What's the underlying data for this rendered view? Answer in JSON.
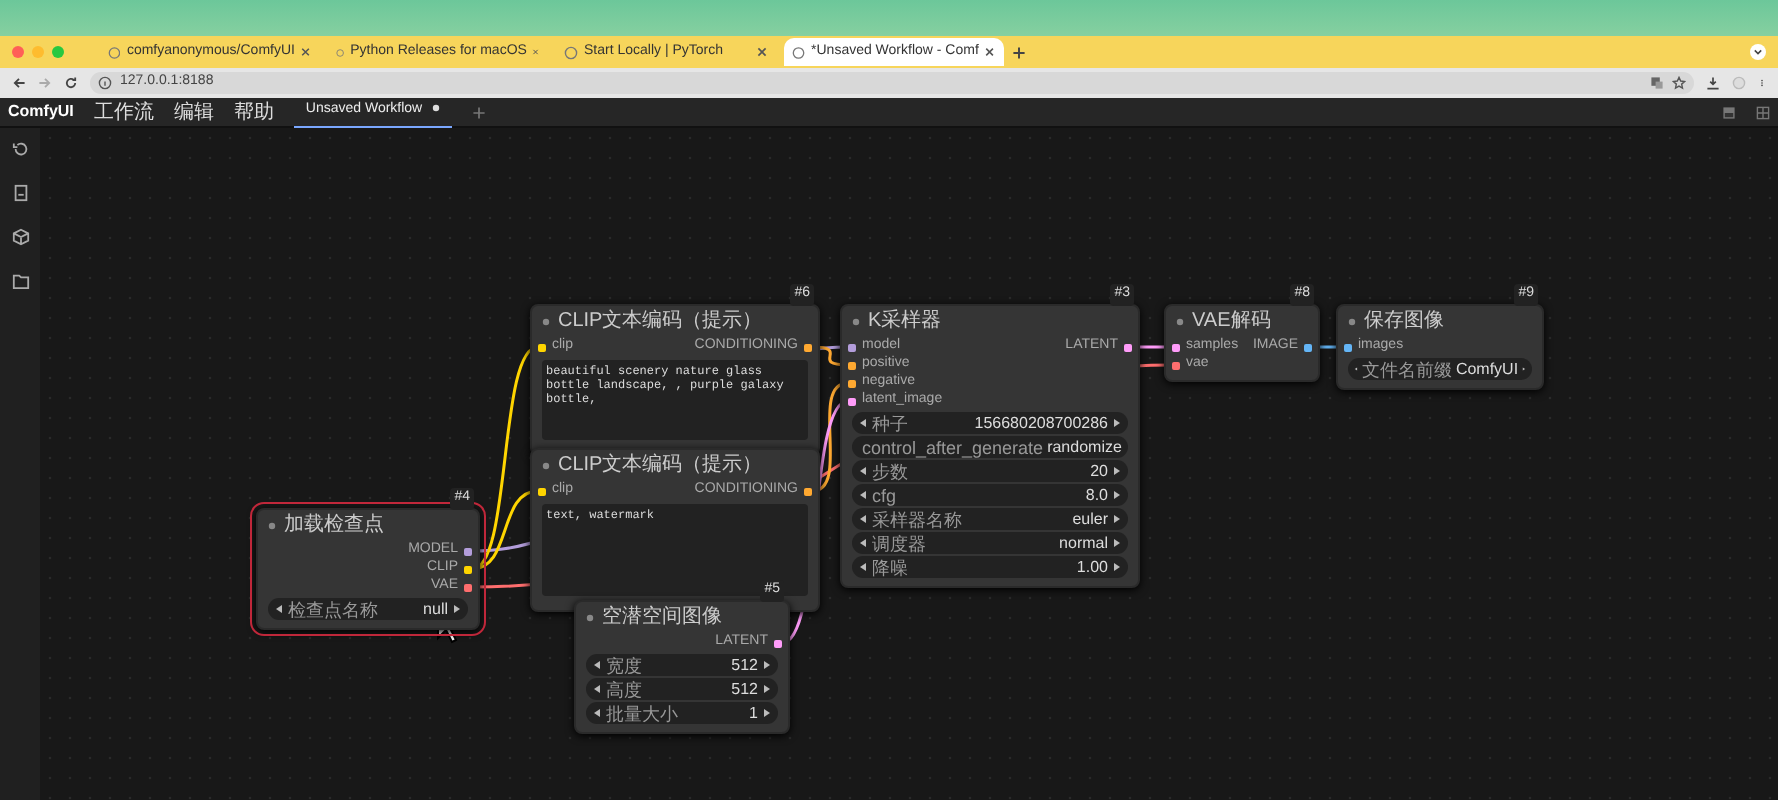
{
  "browser": {
    "tabs": [
      {
        "label": "comfyanonymous/ComfyUI",
        "selected": false
      },
      {
        "label": "Python Releases for macOS",
        "selected": false
      },
      {
        "label": "Start Locally | PyTorch",
        "selected": false
      },
      {
        "label": "*Unsaved Workflow - Comf",
        "selected": true
      }
    ],
    "url": "127.0.0.1:8188"
  },
  "app": {
    "logo": "ComfyUI",
    "menu": [
      "工作流",
      "编辑",
      "帮助"
    ],
    "workflow_tab": {
      "label": "Unsaved Workflow",
      "selected": true
    }
  },
  "nodes": [
    {
      "id": "#4",
      "title": "加载检查点",
      "selected": true,
      "outputs": [
        {
          "label": "MODEL",
          "color": "#b39ddb"
        },
        {
          "label": "CLIP",
          "color": "#ffd500"
        },
        {
          "label": "VAE",
          "color": "#ff6e6e"
        }
      ],
      "widgets": [
        {
          "label": "检查点名称",
          "value": "null"
        }
      ]
    },
    {
      "id": "#6",
      "title": "CLIP文本编码（提示）",
      "selected": false,
      "inputs": [
        {
          "label": "clip",
          "color": "#ffd500"
        }
      ],
      "outputs": [
        {
          "label": "CONDITIONING",
          "color": "#ffa931"
        }
      ],
      "text": "beautiful scenery nature glass bottle landscape, , purple galaxy bottle,"
    },
    {
      "title": "CLIP文本编码（提示）",
      "selected": false,
      "inputs": [
        {
          "label": "clip",
          "color": "#ffd500"
        }
      ],
      "outputs": [
        {
          "label": "CONDITIONING",
          "color": "#ffa931"
        }
      ],
      "text": "text, watermark"
    },
    {
      "id": "#5",
      "title": "空潜空间图像",
      "selected": false,
      "outputs": [
        {
          "label": "LATENT",
          "color": "#ff9cf9"
        }
      ],
      "widgets": [
        {
          "label": "宽度",
          "value": "512"
        },
        {
          "label": "高度",
          "value": "512"
        },
        {
          "label": "批量大小",
          "value": "1"
        }
      ]
    },
    {
      "id": "#3",
      "title": "K采样器",
      "selected": false,
      "inputs": [
        {
          "label": "model",
          "color": "#b39ddb"
        },
        {
          "label": "positive",
          "color": "#ffa931"
        },
        {
          "label": "negative",
          "color": "#ffa931"
        },
        {
          "label": "latent_image",
          "color": "#ff9cf9"
        }
      ],
      "outputs": [
        {
          "label": "LATENT",
          "color": "#ff9cf9"
        }
      ],
      "widgets": [
        {
          "label": "种子",
          "value": "156680208700286"
        },
        {
          "label": "control_after_generate",
          "value": "randomize"
        },
        {
          "label": "步数",
          "value": "20"
        },
        {
          "label": "cfg",
          "value": "8.0"
        },
        {
          "label": "采样器名称",
          "value": "euler"
        },
        {
          "label": "调度器",
          "value": "normal"
        },
        {
          "label": "降噪",
          "value": "1.00"
        }
      ]
    },
    {
      "id": "#8",
      "title": "VAE解码",
      "selected": false,
      "inputs": [
        {
          "label": "samples",
          "color": "#ff9cf9"
        },
        {
          "label": "vae",
          "color": "#ff6e6e"
        }
      ],
      "outputs": [
        {
          "label": "IMAGE",
          "color": "#64b5f6"
        }
      ]
    },
    {
      "id": "#9",
      "title": "保存图像",
      "selected": false,
      "inputs": [
        {
          "label": "images",
          "color": "#64b5f6"
        }
      ],
      "widgets": [
        {
          "label": "文件名前缀",
          "value": "ComfyUI"
        }
      ]
    }
  ]
}
